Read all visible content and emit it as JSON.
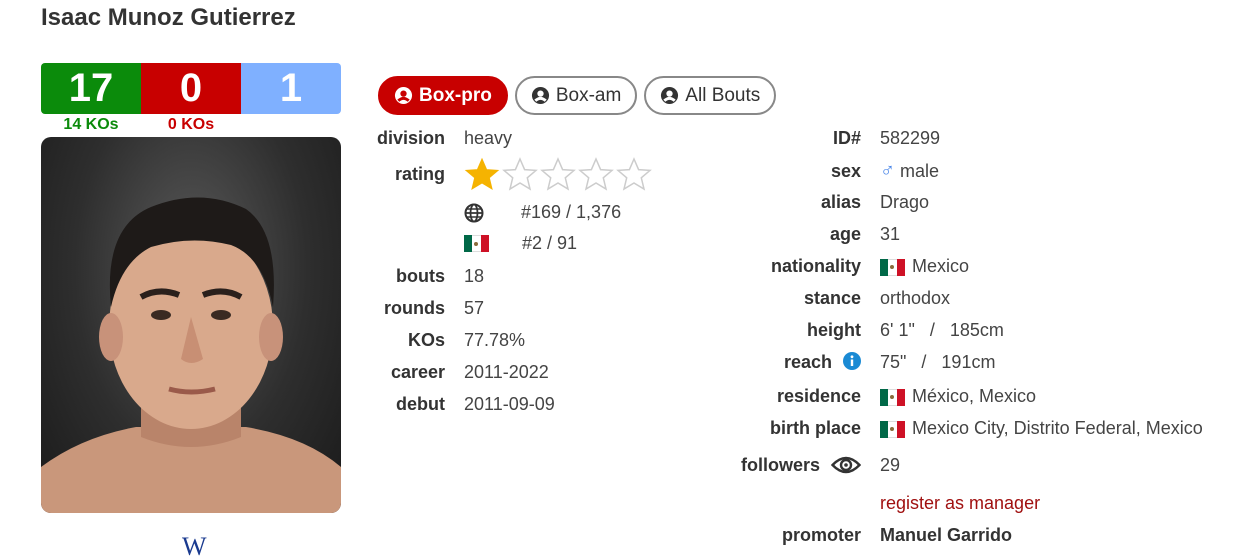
{
  "boxer": {
    "name": "Isaac Munoz Gutierrez",
    "record": {
      "wins": "17",
      "losses": "0",
      "draws": "1"
    },
    "ko_wins": "14 KOs",
    "ko_losses": "0 KOs"
  },
  "wiki_label": "W",
  "tabs": [
    {
      "label": "Box-pro",
      "active": true
    },
    {
      "label": "Box-am",
      "active": false
    },
    {
      "label": "All Bouts",
      "active": false
    }
  ],
  "left_stats": {
    "division_label": "division",
    "division": "heavy",
    "rating_label": "rating",
    "rating_stars": 1,
    "rating_max": 5,
    "world_rank": "#169 / 1,376",
    "country_rank": "#2 / 91",
    "bouts_label": "bouts",
    "bouts": "18",
    "rounds_label": "rounds",
    "rounds": "57",
    "kos_label": "KOs",
    "kos": "77.78%",
    "career_label": "career",
    "career": "2011-2022",
    "debut_label": "debut",
    "debut": "2011-09-09"
  },
  "right_stats": {
    "id_label": "ID#",
    "id": "582299",
    "sex_label": "sex",
    "sex_symbol": "♂",
    "sex": "male",
    "alias_label": "alias",
    "alias": "Drago",
    "age_label": "age",
    "age": "31",
    "nationality_label": "nationality",
    "nationality": "Mexico",
    "stance_label": "stance",
    "stance": "orthodox",
    "height_label": "height",
    "height": "6' 1\"   /   185cm",
    "reach_label": "reach",
    "reach": "75\"   /   191cm",
    "residence_label": "residence",
    "residence": "México, Mexico",
    "birth_place_label": "birth place",
    "birth_place": "Mexico City, Distrito Federal, Mexico",
    "followers_label": "followers",
    "followers": "29",
    "register_manager": "register as manager",
    "promoter_label": "promoter",
    "promoter": "Manuel Garrido"
  },
  "colors": {
    "win": "#0b8b0b",
    "loss": "#c80000",
    "draw": "#7fb0ff",
    "star": "#f5b301"
  }
}
